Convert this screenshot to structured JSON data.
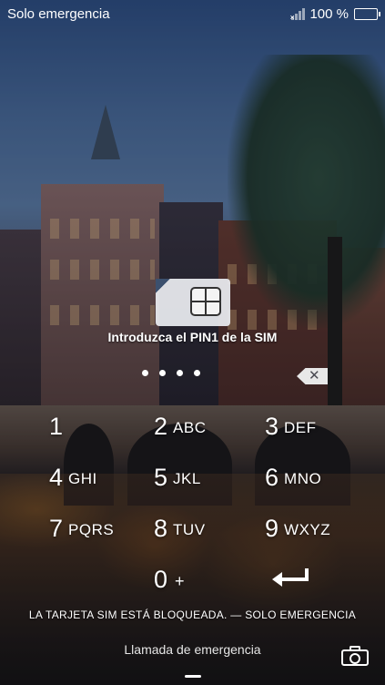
{
  "status_bar": {
    "carrier": "Solo emergencia",
    "battery_percent": "100 %",
    "signal_icon": "signal-no-sim-icon",
    "battery_icon": "battery-full-icon",
    "battery_level": 1.0
  },
  "sim_prompt": {
    "icon": "sim-card-icon",
    "title": "Introduzca el PIN1 de la SIM",
    "entered_digits": 4,
    "delete_icon": "backspace-icon"
  },
  "keypad": {
    "keys": [
      {
        "digit": "1",
        "letters": ""
      },
      {
        "digit": "2",
        "letters": "ABC"
      },
      {
        "digit": "3",
        "letters": "DEF"
      },
      {
        "digit": "4",
        "letters": "GHI"
      },
      {
        "digit": "5",
        "letters": "JKL"
      },
      {
        "digit": "6",
        "letters": "MNO"
      },
      {
        "digit": "7",
        "letters": "PQRS"
      },
      {
        "digit": "8",
        "letters": "TUV"
      },
      {
        "digit": "9",
        "letters": "WXYZ"
      }
    ],
    "zero": {
      "digit": "0",
      "letters": "+"
    },
    "enter_icon": "enter-arrow-icon"
  },
  "footer": {
    "locked_message": "LA TARJETA SIM ESTÁ BLOQUEADA. — SOLO EMERGENCIA",
    "emergency_call": "Llamada de emergencia",
    "camera_icon": "camera-icon"
  }
}
